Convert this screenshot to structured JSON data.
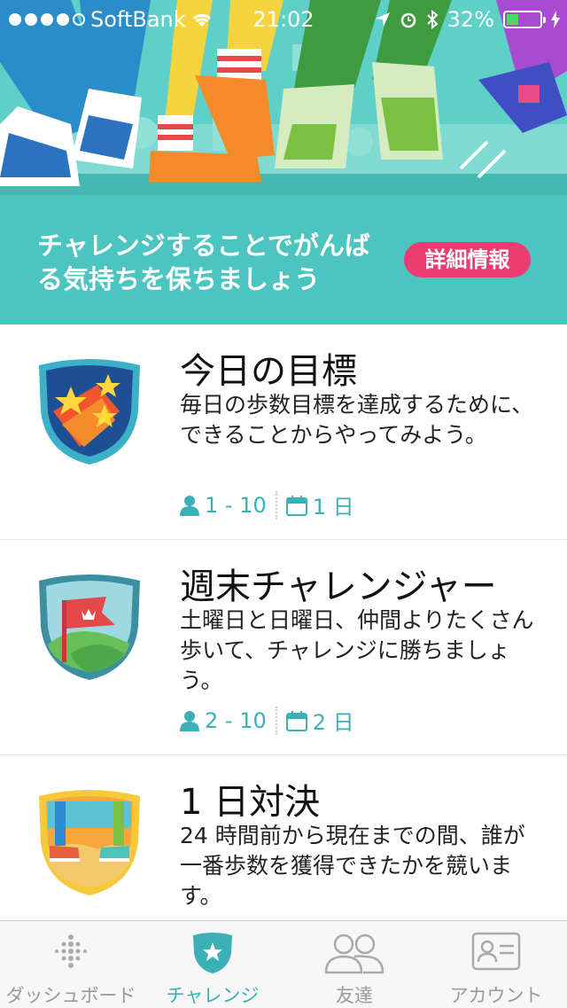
{
  "status_bar": {
    "carrier": "SoftBank",
    "time": "21:02",
    "battery": "32%"
  },
  "promo": {
    "text": "チャレンジすることでがんばる気持ちを保ちましょう",
    "button": "詳細情報"
  },
  "challenges": [
    {
      "title": "今日の目標",
      "description": "毎日の歩数目標を達成するために、できることからやってみよう。",
      "participants": "1 - 10",
      "duration": "1 日",
      "badge_icon": "stars-badge-icon"
    },
    {
      "title": "週末チャレンジャー",
      "description": "土曜日と日曜日、仲間よりたくさん歩いて、チャレンジに勝ちましょう。",
      "participants": "2 - 10",
      "duration": "2 日",
      "badge_icon": "flag-badge-icon"
    },
    {
      "title": "1 日対決",
      "description": "24 時間前から現在までの間、誰が一番歩数を獲得できたかを競います。",
      "badge_icon": "sneakers-badge-icon"
    }
  ],
  "tabs": [
    {
      "label": "ダッシュボード",
      "icon": "dots-grid-icon"
    },
    {
      "label": "チャレンジ",
      "icon": "star-shield-icon",
      "active": true
    },
    {
      "label": "友達",
      "icon": "friends-icon"
    },
    {
      "label": "アカウント",
      "icon": "id-card-icon"
    }
  ],
  "colors": {
    "teal": "#4cc4c0",
    "accent": "#3bb0b7",
    "pink": "#ea3d72"
  }
}
